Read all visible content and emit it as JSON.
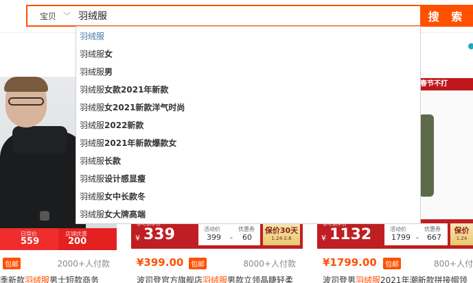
{
  "search": {
    "scope_label": "宝贝",
    "query": "羽绒服",
    "button_label": "搜 索",
    "suggestions": [
      {
        "prefix": "羽绒服",
        "rest": ""
      },
      {
        "prefix": "羽绒服",
        "rest": "女"
      },
      {
        "prefix": "羽绒服",
        "rest": "男"
      },
      {
        "prefix": "羽绒服",
        "rest": "女款2021年新款"
      },
      {
        "prefix": "羽绒服",
        "rest": "女2021新款洋气时尚"
      },
      {
        "prefix": "羽绒服",
        "rest": "2022新款"
      },
      {
        "prefix": "羽绒服",
        "rest": "2021年新款爆款女"
      },
      {
        "prefix": "羽绒服",
        "rest": "长款"
      },
      {
        "prefix": "羽绒服",
        "rest": "设计感显瘦"
      },
      {
        "prefix": "羽绒服",
        "rest": "女中长款冬"
      },
      {
        "prefix": "羽绒服",
        "rest": "女大牌高端"
      }
    ]
  },
  "products": [
    {
      "band_left_label": "日常价",
      "band_left_value": "559",
      "band_right_label": "店铺优惠",
      "band_right_value": "200",
      "price": "",
      "tag": "包邮",
      "paid": "2000+人付款",
      "title_pre": "季新款",
      "title_hl": "羽绒服",
      "title_post": "男士短款商务"
    },
    {
      "band_tag": "参考到手价",
      "band_yen": "¥",
      "band_price": "339",
      "col1_label": "活动价",
      "col1_value": "399",
      "sep": "-",
      "col2_label": "优惠券",
      "col2_value": "60",
      "gold_title": "保价30天",
      "gold_sub": "1.24-2.8",
      "price": "¥399.00",
      "tag": "包邮",
      "paid": "8000+人付款",
      "title_pre": "波司登官方旗舰店",
      "title_hl": "羽绒服",
      "title_post": "男款立领晶睫轻柔"
    },
    {
      "banner": "春节不打",
      "band_tag": "参考到手价",
      "band_yen": "¥",
      "band_price": "1132",
      "col1_label": "活动价",
      "col1_value": "1799",
      "sep": "-",
      "col2_label": "优惠券",
      "col2_value": "667",
      "gold_title": "保价",
      "gold_sub": "1.24",
      "price": "¥1799.00",
      "tag": "包邮",
      "paid": "800+人付",
      "title_pre": "波司登男",
      "title_hl": "羽绒服",
      "title_post": "2021年潮新款拼接帽领"
    }
  ],
  "colors": {
    "accent": "#ff5000",
    "suggestion_active": "#4a7ba6",
    "band_red": "#bf1e22"
  }
}
